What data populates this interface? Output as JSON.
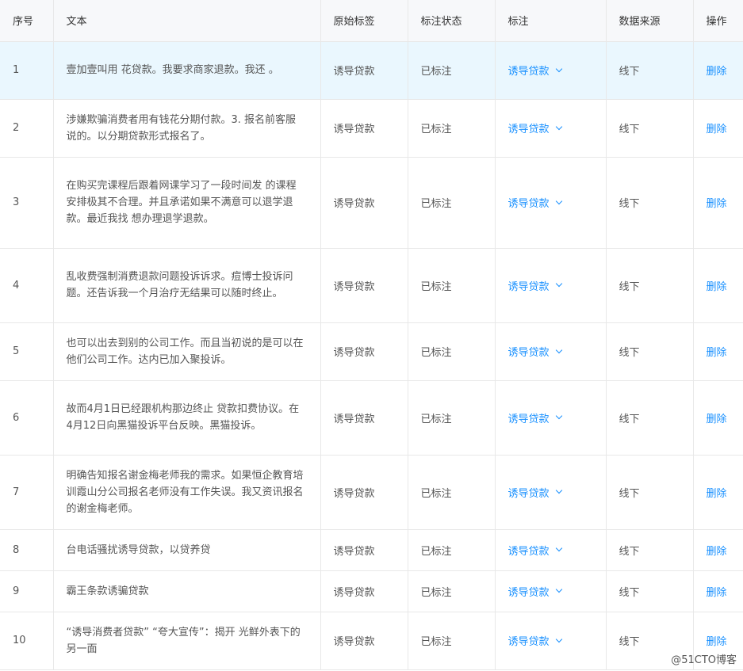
{
  "columns": [
    "序号",
    "文本",
    "原始标签",
    "标注状态",
    "标注",
    "数据来源",
    "操作"
  ],
  "rows": [
    {
      "index": "1",
      "text": "壹加壹叫用   花贷款。我要求商家退款。我还            。",
      "original_label": "诱导贷款",
      "status": "已标注",
      "annotation": "诱导贷款",
      "source": "线下",
      "action": "删除"
    },
    {
      "index": "2",
      "text": "        涉嫌欺骗消费者用有钱花分期付款。3. 报名前客服说的。以分期贷款形式报名了。",
      "original_label": "诱导贷款",
      "status": "已标注",
      "annotation": "诱导贷款",
      "source": "线下",
      "action": "删除"
    },
    {
      "index": "3",
      "text": "在购买完课程后跟着网课学习了一段时间发   的课程安排极其不合理。并且承诺如果不满意可以退学退款。最近我找      想办理退学退款。",
      "original_label": "诱导贷款",
      "status": "已标注",
      "annotation": "诱导贷款",
      "source": "线下",
      "action": "删除"
    },
    {
      "index": "4",
      "text": "乱收费强制消费退款问题投诉诉求。痘博士投诉问题。还告诉我一个月治疗无结果可以随时终止。",
      "original_label": "诱导贷款",
      "status": "已标注",
      "annotation": "诱导贷款",
      "source": "线下",
      "action": "删除"
    },
    {
      "index": "5",
      "text": "也可以出去到别的公司工作。而且当初说的是可以在他们公司工作。达内已加入聚投诉。",
      "original_label": "诱导贷款",
      "status": "已标注",
      "annotation": "诱导贷款",
      "source": "线下",
      "action": "删除"
    },
    {
      "index": "6",
      "text": "故而4月1日已经跟机构那边终止     贷款扣费协议。在4月12日向黑猫投诉平台反映。黑猫投诉。",
      "original_label": "诱导贷款",
      "status": "已标注",
      "annotation": "诱导贷款",
      "source": "线下",
      "action": "删除"
    },
    {
      "index": "7",
      "text": "明确告知报名谢金梅老师我的需求。如果恒企教育培训霞山分公司报名老师没有工作失误。我又资讯报名的谢金梅老师。",
      "original_label": "诱导贷款",
      "status": "已标注",
      "annotation": "诱导贷款",
      "source": "线下",
      "action": "删除"
    },
    {
      "index": "8",
      "text": "        台电话骚扰诱导贷款，以贷养贷",
      "original_label": "诱导贷款",
      "status": "已标注",
      "annotation": "诱导贷款",
      "source": "线下",
      "action": "删除"
    },
    {
      "index": "9",
      "text": "        霸王条款诱骗贷款",
      "original_label": "诱导贷款",
      "status": "已标注",
      "annotation": "诱导贷款",
      "source": "线下",
      "action": "删除"
    },
    {
      "index": "10",
      "text": "“诱导消费者贷款” “夸大宣传”：揭开         光鲜外表下的另一面",
      "original_label": "诱导贷款",
      "status": "已标注",
      "annotation": "诱导贷款",
      "source": "线下",
      "action": "删除"
    }
  ],
  "watermark": "@51CTO博客"
}
